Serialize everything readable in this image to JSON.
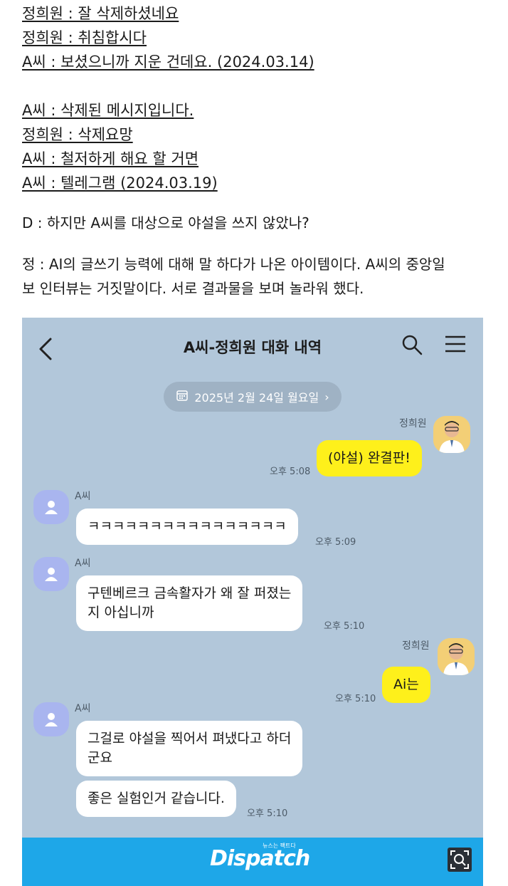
{
  "quotes_group1": [
    "정희원 : 잘 삭제하셨네요",
    "정희원 : 취침합시다",
    "A씨 : 보셨으니까 지운 건데요. (2024.03.14)"
  ],
  "quotes_group2": [
    "A씨 : 삭제된 메시지입니다.",
    "정희원 : 삭제요망",
    "A씨 : 철저하게 해요 할 거면",
    "A씨 : 텔레그램 (2024.03.19)"
  ],
  "question": "D : 하지만 A씨를 대상으로 야설을 쓰지 않았나?",
  "answer_lines": [
    "정 : AI의 글쓰기 능력에 대해 말 하다가 나온 아이템이다. A씨의 중앙일",
    "보 인터뷰는 거짓말이다. 서로 결과물을 보며 놀라워 했다."
  ],
  "chat": {
    "title": "A씨-정희원 대화 내역",
    "date": "2025년 2월 24일 월요일",
    "date_arrow": "›",
    "icons": {
      "back": "back-arrow-icon",
      "search": "search-icon",
      "menu": "hamburger-menu-icon",
      "calendar": "calendar-icon"
    },
    "colors": {
      "background": "#b2c7da",
      "my_bubble": "#fef01b",
      "other_bubble": "#ffffff"
    },
    "messages": [
      {
        "sender": "정희원",
        "text": "(야설) 완결판!",
        "time": "오후 5:08"
      },
      {
        "sender": "A씨",
        "text": "ㅋㅋㅋㅋㅋㅋㅋㅋㅋㅋㅋㅋㅋㅋㅋㅋ",
        "time": "오후 5:09"
      },
      {
        "sender": "A씨",
        "text_lines": [
          "구텐베르크 금속활자가 왜 잘 퍼졌는",
          "지 아십니까"
        ],
        "time": "오후 5:10"
      },
      {
        "sender": "정희원",
        "text": "Ai는",
        "time": "오후 5:10"
      },
      {
        "sender": "A씨",
        "text_lines": [
          "그걸로 야설을 찍어서 펴냈다고 하더",
          "군요"
        ]
      },
      {
        "sender": "A씨",
        "text": "좋은 실험인거 같습니다.",
        "time": "오후 5:10"
      }
    ]
  },
  "footer": {
    "logo": "Dispatch",
    "logo_tagline": "뉴스는 팩트다",
    "color": "#1ea7e8",
    "icon": "image-search-icon"
  }
}
